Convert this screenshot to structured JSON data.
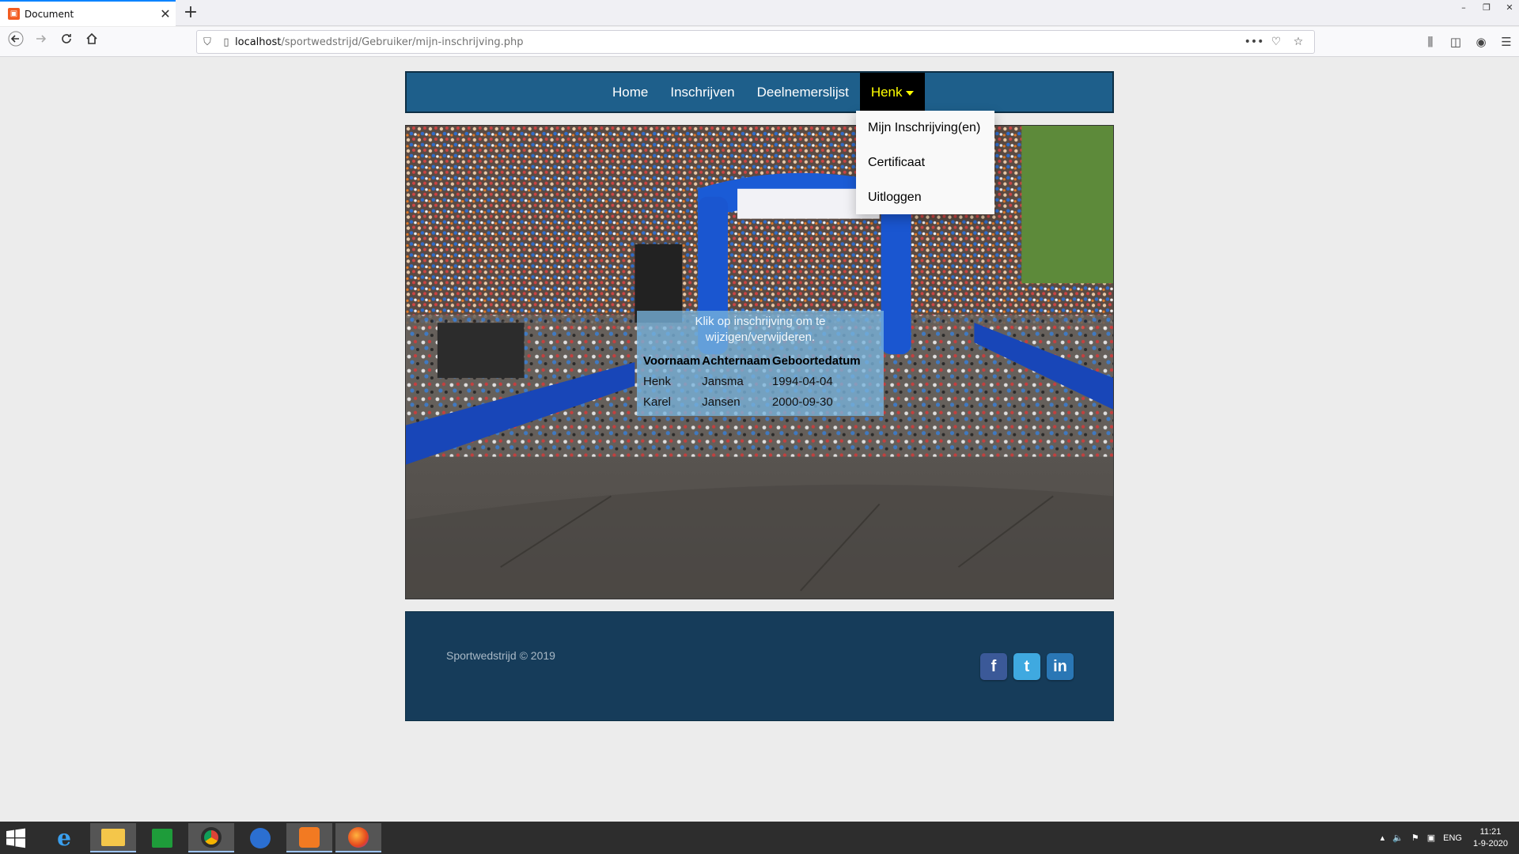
{
  "browser": {
    "tab_title": "Document",
    "tab_close": "✕",
    "new_tab": "+",
    "url_host": "localhost",
    "url_path": "/sportwedstrijd/Gebruiker/mijn-inschrijving.php",
    "window_controls": [
      "–",
      "❐",
      "✕"
    ]
  },
  "nav": {
    "links": [
      "Home",
      "Inschrijven",
      "Deelnemerslijst"
    ],
    "user_menu_label": "Henk"
  },
  "dropdown": {
    "items": [
      "Mijn Inschrijving(en)",
      "Certificaat",
      "Uitloggen"
    ]
  },
  "panel": {
    "info": "Klik op inschrijving om te wijzigen/verwijderen.",
    "columns": [
      "Voornaam",
      "Achternaam",
      "Geboortedatum"
    ],
    "rows": [
      [
        "Henk",
        "Jansma",
        "1994-04-04"
      ],
      [
        "Karel",
        "Jansen",
        "2000-09-30"
      ]
    ]
  },
  "footer": {
    "copyright": "Sportwedstrijd © 2019",
    "social": [
      "f",
      "t",
      "in"
    ]
  },
  "taskbar": {
    "lang": "ENG",
    "time": "11:21",
    "date": "1-9-2020"
  },
  "colors": {
    "nav_bg": "#1e5f8b",
    "active_menu_text": "#ffff00",
    "footer_bg": "#163c5a"
  }
}
